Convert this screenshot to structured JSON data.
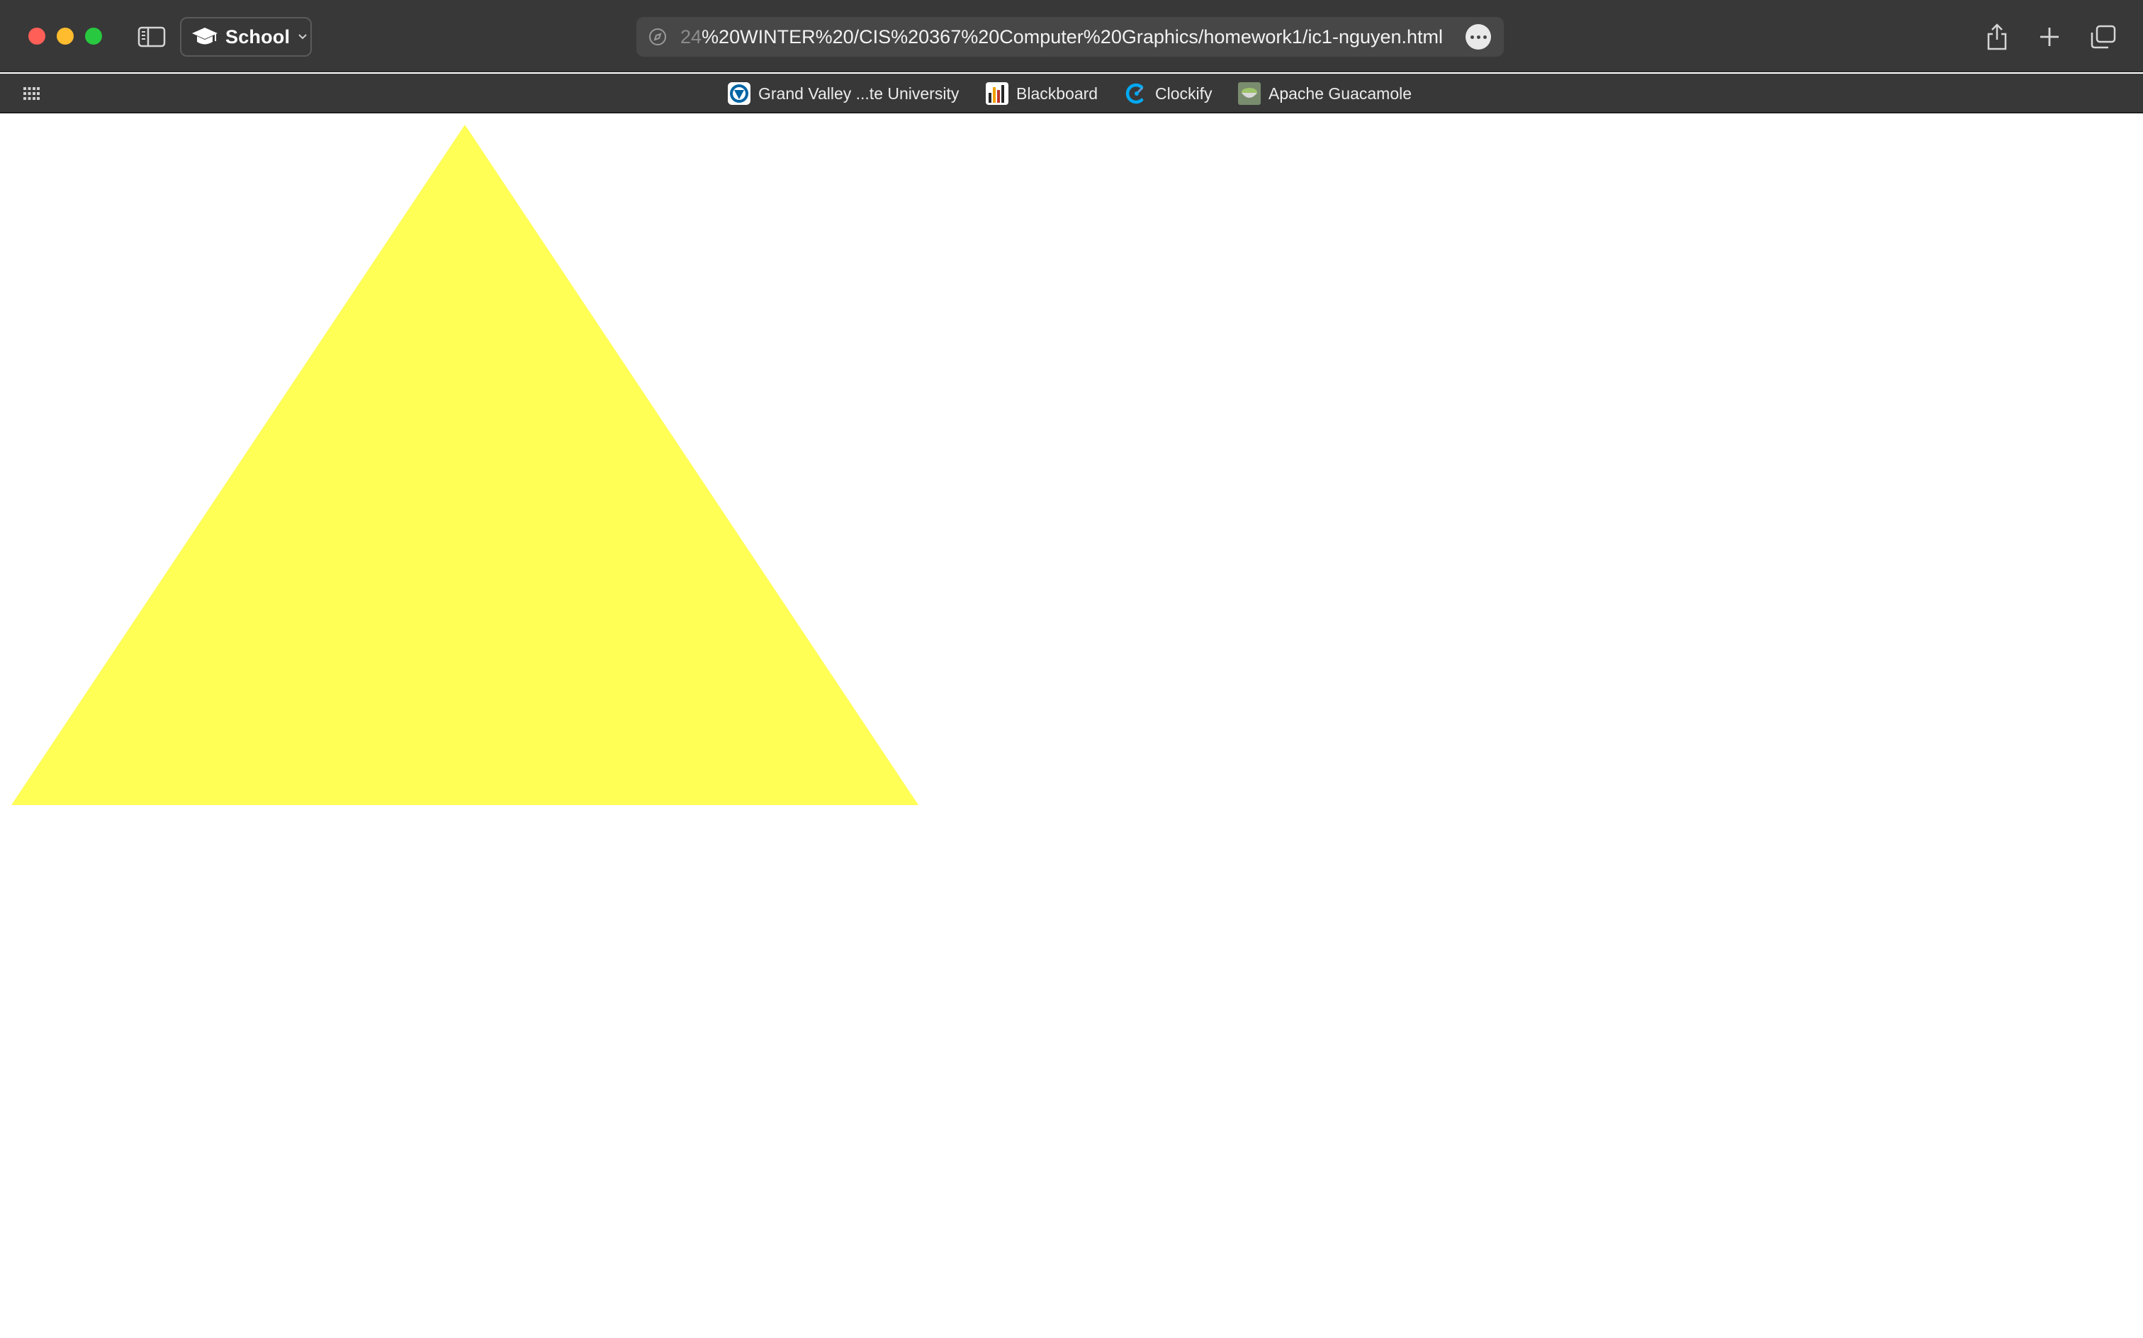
{
  "window": {
    "buttons": {
      "close": "close",
      "minimize": "minimize",
      "zoom": "zoom"
    }
  },
  "toolbar": {
    "tab_group_label": "School",
    "url_faded_prefix": "24",
    "url_text": "%20WINTER%20/CIS%20367%20Computer%20Graphics/homework1/ic1-nguyen.html"
  },
  "favorites": [
    {
      "label": "Grand Valley ...te University",
      "icon": "gvsu-logo-icon"
    },
    {
      "label": "Blackboard",
      "icon": "blackboard-icon"
    },
    {
      "label": "Clockify",
      "icon": "clockify-icon"
    },
    {
      "label": "Apache Guacamole",
      "icon": "guacamole-icon"
    }
  ],
  "page": {
    "shape": "triangle",
    "fill_color": "#ffff55",
    "background_color": "#ffffff"
  },
  "colors": {
    "toolbar_bg": "#383838",
    "url_field_bg": "#474747",
    "close": "#ff5f57",
    "minimize": "#febc2e",
    "zoom": "#28c840"
  }
}
